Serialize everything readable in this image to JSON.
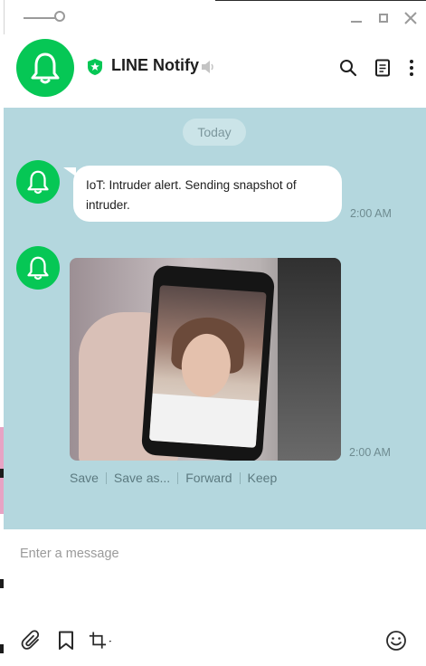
{
  "window": {
    "min_label": "",
    "max_label": "",
    "close_label": ""
  },
  "header": {
    "title": "LINE Notify",
    "icons": [
      "shield-icon",
      "mute-icon",
      "search-icon",
      "notes-icon",
      "more-icon"
    ]
  },
  "chat": {
    "date_label": "Today",
    "messages": [
      {
        "type": "text",
        "text": "IoT: Intruder alert. Sending snapshot of intruder.",
        "time": "2:00 AM"
      },
      {
        "type": "image",
        "time": "2:00 AM",
        "actions": [
          "Save",
          "Save as...",
          "Forward",
          "Keep"
        ]
      }
    ]
  },
  "composer": {
    "placeholder": "Enter a message",
    "tools": [
      "paperclip-icon",
      "bookmark-icon",
      "crop-icon",
      "emoji-icon"
    ]
  },
  "colors": {
    "brand_green": "#06c755",
    "chat_background": "#b4d7de",
    "date_pill": "#cbe4e8"
  }
}
